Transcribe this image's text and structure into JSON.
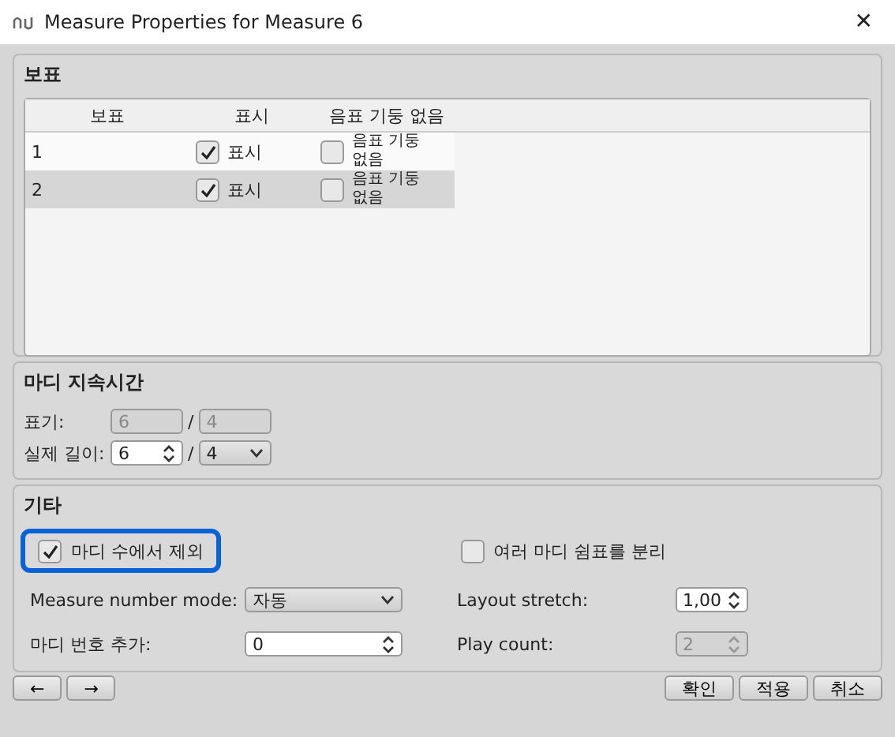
{
  "window": {
    "title": "Measure Properties for Measure 6",
    "close": "✕"
  },
  "staves": {
    "title": "보표",
    "columns": [
      "보표",
      "표시",
      "음표 기둥 없음"
    ],
    "rows": [
      {
        "staff": "1",
        "visible": {
          "label": "표시",
          "checked": true
        },
        "stemless": {
          "label": "음표 기둥 없음",
          "checked": false
        },
        "selected": false
      },
      {
        "staff": "2",
        "visible": {
          "label": "표시",
          "checked": true
        },
        "stemless": {
          "label": "음표 기둥 없음",
          "checked": false
        },
        "selected": true
      }
    ]
  },
  "duration": {
    "title": "마디 지속시간",
    "nominal_label": "표기:",
    "nominal_num": "6",
    "nominal_den": "4",
    "actual_label": "실제 길이:",
    "actual_num": "6",
    "actual_den": "4",
    "separator": "/"
  },
  "other": {
    "title": "기타",
    "exclude": {
      "label": "마디 수에서 제외",
      "checked": true,
      "focused": true
    },
    "split_rest": {
      "label": "여러 마디 쉼표를 분리",
      "checked": false
    },
    "fields": [
      {
        "kind": "dropdown",
        "label": "Measure number mode:",
        "value": "자동",
        "disabled": false
      },
      {
        "kind": "spin",
        "label": "Layout stretch:",
        "value": "1,00",
        "disabled": false
      },
      {
        "kind": "spin",
        "label": "마디 번호 추가:",
        "value": "0",
        "disabled": false
      },
      {
        "kind": "spin",
        "label": "Play count:",
        "value": "2",
        "disabled": true
      }
    ]
  },
  "nav_buttons": [
    "←",
    "→"
  ],
  "buttons": [
    "확인",
    "적용",
    "취소"
  ]
}
